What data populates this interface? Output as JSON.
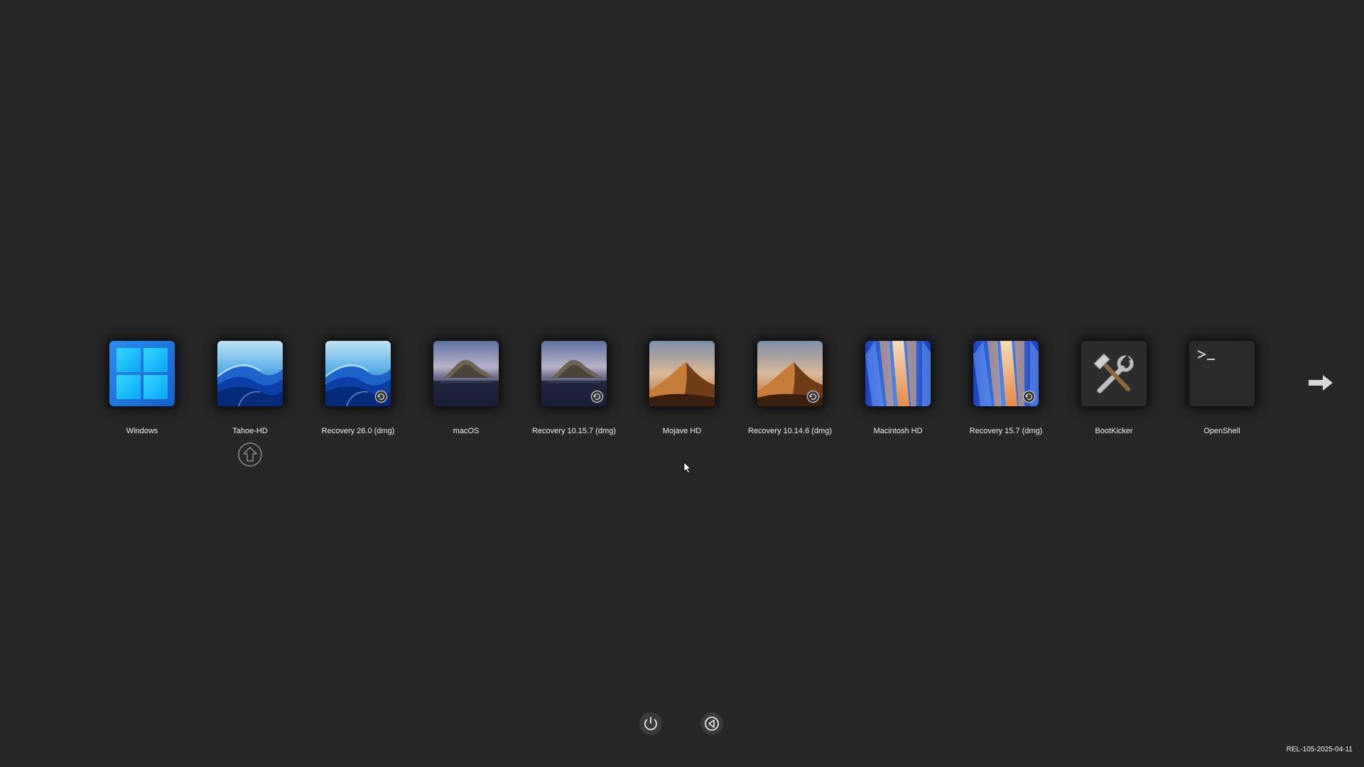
{
  "boot_entries": [
    {
      "label": "Windows",
      "icon": "windows-logo-icon",
      "badge": false
    },
    {
      "label": "Tahoe-HD",
      "icon": "macos-tahoe-wallpaper-icon",
      "badge": false,
      "selected": true
    },
    {
      "label": "Recovery 26.0 (dmg)",
      "icon": "macos-tahoe-wallpaper-icon",
      "badge": true
    },
    {
      "label": "macOS",
      "icon": "macos-catalina-wallpaper-icon",
      "badge": false
    },
    {
      "label": "Recovery 10.15.7 (dmg)",
      "icon": "macos-catalina-wallpaper-icon",
      "badge": true
    },
    {
      "label": "Mojave HD",
      "icon": "macos-mojave-wallpaper-icon",
      "badge": false
    },
    {
      "label": "Recovery 10.14.6 (dmg)",
      "icon": "macos-mojave-wallpaper-icon",
      "badge": true
    },
    {
      "label": "Macintosh HD",
      "icon": "macos-sequoia-wallpaper-icon",
      "badge": false
    },
    {
      "label": "Recovery 15.7 (dmg)",
      "icon": "macos-sequoia-wallpaper-icon",
      "badge": true
    },
    {
      "label": "BootKicker",
      "icon": "tools-icon",
      "badge": false
    },
    {
      "label": "OpenShell",
      "icon": "terminal-icon",
      "badge": false
    }
  ],
  "next_page_icon": "right-arrow-icon",
  "selected_indicator_icon": "up-arrow-circle-icon",
  "tools": {
    "shutdown_icon": "power-icon",
    "restart_icon": "restart-icon"
  },
  "version": "REL-105-2025-04-11",
  "colors": {
    "background": "#262626",
    "text": "#f2f2f2",
    "windows_blue": "#1e7ae0"
  }
}
